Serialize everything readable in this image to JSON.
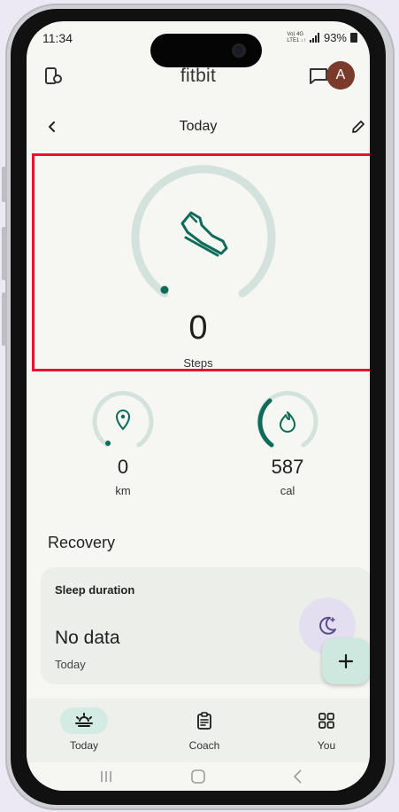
{
  "status_bar": {
    "time": "11:34",
    "network_top": "Vo) 4G",
    "network_bottom": "LTE1 ↓↑",
    "battery": "93%"
  },
  "app_bar": {
    "title": "fitbit",
    "avatar_initial": "A"
  },
  "date_nav": {
    "title": "Today"
  },
  "steps": {
    "value": "0",
    "label": "Steps",
    "progress": 0
  },
  "metrics": [
    {
      "value": "0",
      "label": "km",
      "progress": 0
    },
    {
      "value": "587",
      "label": "cal",
      "progress": 0.25
    }
  ],
  "recovery": {
    "section_title": "Recovery",
    "sleep_card": {
      "title": "Sleep duration",
      "value": "No data",
      "sub": "Today"
    }
  },
  "bottom_nav": [
    {
      "label": "Today",
      "icon": "sunrise-icon",
      "active": true
    },
    {
      "label": "Coach",
      "icon": "clipboard-icon",
      "active": false
    },
    {
      "label": "You",
      "icon": "grid-icon",
      "active": false
    }
  ],
  "colors": {
    "accent": "#0e6b5a",
    "track": "#d3e2dd",
    "highlight": "#e8152a",
    "avatar": "#7b3b2c"
  }
}
